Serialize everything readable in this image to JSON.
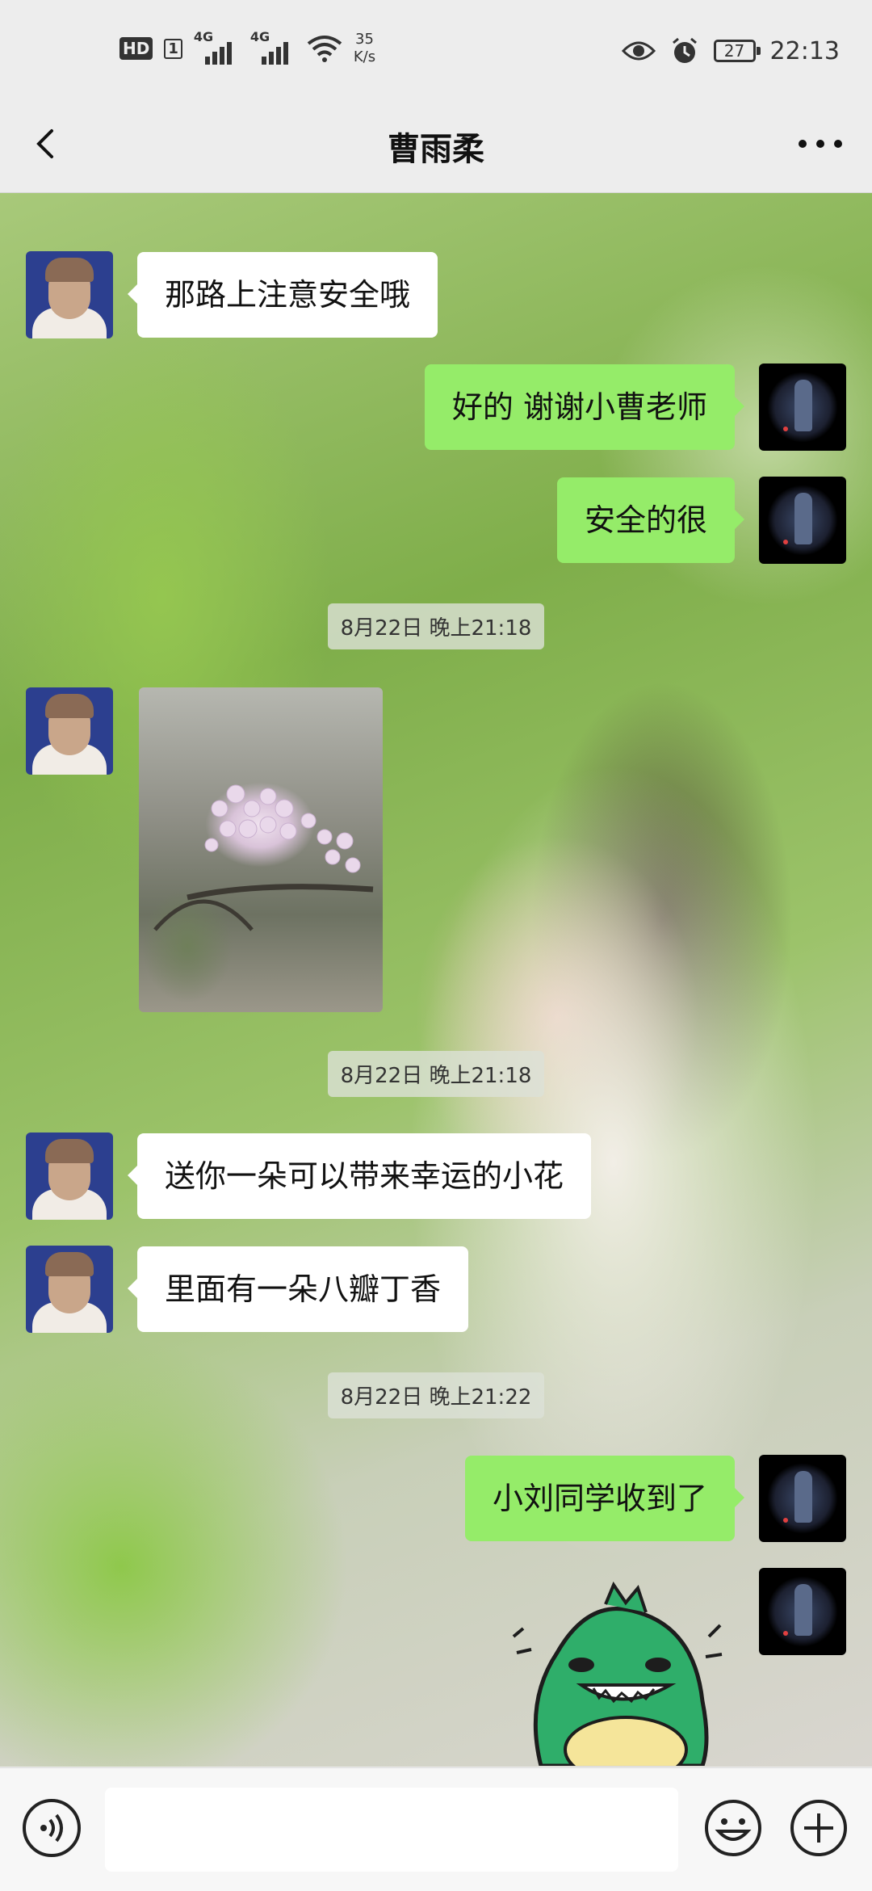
{
  "status_bar": {
    "hd": "HD",
    "sim": "1",
    "network1": "4G",
    "network2": "4G",
    "speed_value": "35",
    "speed_unit": "K/s",
    "battery": "27",
    "time": "22:13",
    "icons": [
      "hd-icon",
      "signal-icon",
      "wifi-icon",
      "eye-icon",
      "alarm-icon",
      "battery-icon"
    ]
  },
  "header": {
    "title": "曹雨柔",
    "back_icon": "chevron-left-icon",
    "more_icon": "more-horizontal-icon"
  },
  "messages": [
    {
      "side": "in",
      "type": "text",
      "text": "那路上注意安全哦"
    },
    {
      "side": "out",
      "type": "text",
      "text": "好的 谢谢小曹老师"
    },
    {
      "side": "out",
      "type": "text",
      "text": "安全的很"
    },
    {
      "type": "timestamp",
      "text": "8月22日 晚上21:18"
    },
    {
      "side": "in",
      "type": "image",
      "description_icon": "flower-photo"
    },
    {
      "type": "timestamp",
      "text": "8月22日 晚上21:18"
    },
    {
      "side": "in",
      "type": "text",
      "text": "送你一朵可以带来幸运的小花"
    },
    {
      "side": "in",
      "type": "text",
      "text": "里面有一朵八瓣丁香"
    },
    {
      "type": "timestamp",
      "text": "8月22日 晚上21:22"
    },
    {
      "side": "out",
      "type": "text",
      "text": "小刘同学收到了"
    },
    {
      "side": "out",
      "type": "sticker",
      "description_icon": "green-dinosaur-sticker"
    }
  ],
  "input_bar": {
    "voice_icon": "voice-icon",
    "text_value": "",
    "emoji_icon": "emoji-icon",
    "plus_icon": "plus-icon"
  },
  "colors": {
    "incoming_bubble": "#ffffff",
    "outgoing_bubble": "#95ec69",
    "header_bg": "#ededed"
  }
}
